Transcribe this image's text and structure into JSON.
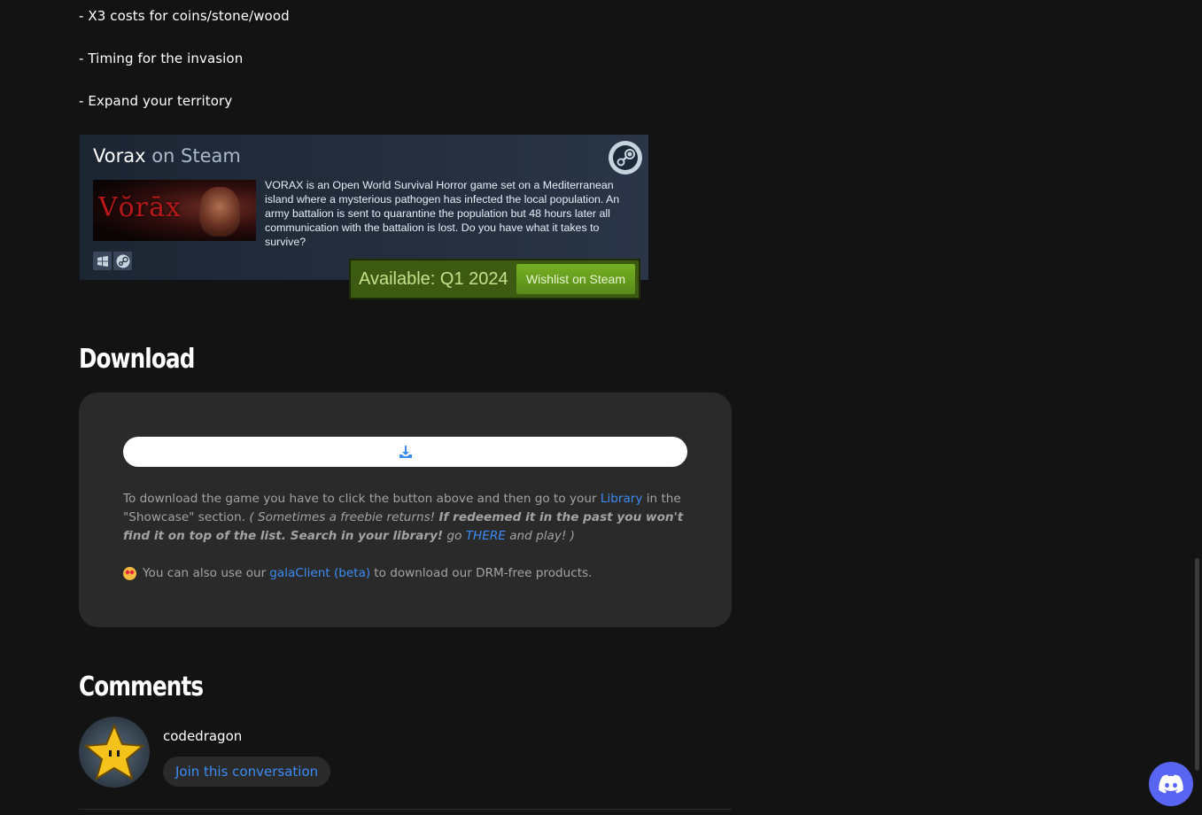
{
  "features": [
    "- X3 costs for coins/stone/wood",
    "- Timing for the invasion",
    "- Expand your territory"
  ],
  "steam_widget": {
    "game_name": "Vorax",
    "on_steam": "on Steam",
    "capsule_logo": "Vŏrāx",
    "description": "VORAX is an Open World Survival Horror game set on a Mediterranean island where a mysterious pathogen has infected the local population. An army battalion is sent to quarantine the population but 48 hours later all communication with the battalion is lost. Do you have what it takes to survive?",
    "platforms": [
      "windows-icon",
      "steam-icon"
    ],
    "availability": "Available: Q1 2024",
    "wishlist_label": "Wishlist on Steam"
  },
  "download": {
    "heading": "Download",
    "text_before_library": "To download the game you have to click the button above and then go to your ",
    "library_link": "Library",
    "text_after_library": " in the \"Showcase\" section. ",
    "italic_1": "( Sometimes a freebie returns! ",
    "bold_italic": "If redeemed it in the past you won't find it on top of the list. Search in your library!",
    "italic_2": " go ",
    "there_link": "THERE",
    "italic_3": " and play! )",
    "client_before": "You can also use our",
    "client_link": "galaClient (beta)",
    "client_after": "to download our DRM-free products."
  },
  "comments": {
    "heading": "Comments",
    "username": "codedragon",
    "join_label": "Join this conversation"
  },
  "colors": {
    "background": "#131313",
    "panel": "#2a2a2a",
    "link": "#3b8cf5",
    "steam_green": "#75b022",
    "discord": "#5865f2"
  }
}
